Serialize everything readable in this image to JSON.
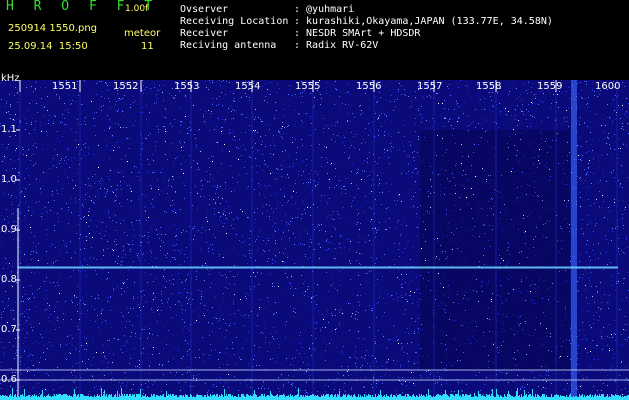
{
  "header": {
    "app_name": "H R O F F T",
    "version": "1.00f",
    "filename": "250914 1550.png",
    "datetime": "25.09.14  15:50",
    "meteor_label": "meteor",
    "meteor_count": "11",
    "observer_label": "Ovserver",
    "observer_value": ": @yuhmari",
    "location_label": "Receiving Location",
    "location_value": ": kurashiki,Okayama,JAPAN (133.77E, 34.58N)",
    "receiver_label": "Receiver",
    "receiver_value": ": NESDR SMArt + HDSDR",
    "antenna_label": "Reciving antenna",
    "antenna_value": ": Radix RV-62V"
  },
  "chart_data": {
    "type": "heatmap",
    "ylabel": "kHz",
    "x_ticks": [
      "1551",
      "1552",
      "1553",
      "1554",
      "1555",
      "1556",
      "1557",
      "1558",
      "1559",
      "1600"
    ],
    "y_ticks": [
      "1.1",
      "1.0",
      "0.9",
      "0.8",
      "0.7",
      "0.6"
    ],
    "ylim": [
      0.58,
      1.2
    ],
    "horizontal_lines_khz": [
      0.825,
      0.62,
      0.6
    ],
    "vertical_band_minute": "1559.5",
    "colors": {
      "background": "#0a0a7a",
      "noise": "#2a3cff",
      "line": "#66ccff",
      "baseline": "#33ddff"
    }
  }
}
